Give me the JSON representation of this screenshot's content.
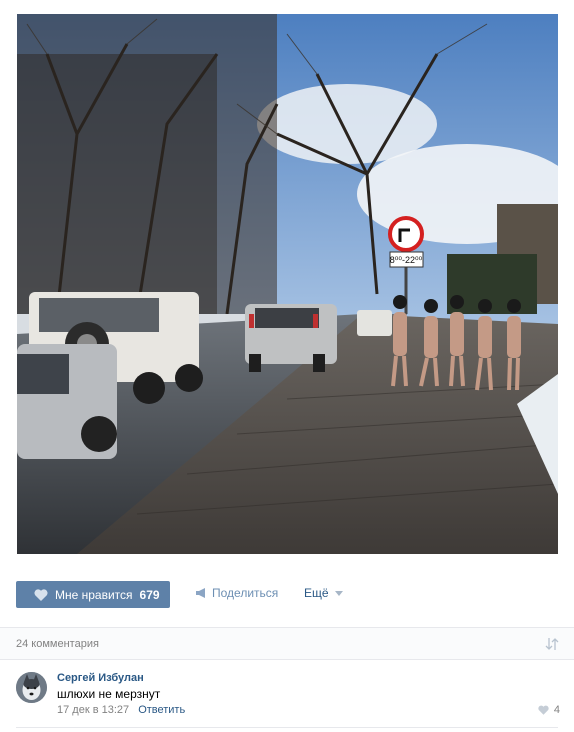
{
  "post": {
    "like_label": "Мне нравится",
    "like_count": "679",
    "share_label": "Поделиться",
    "more_label": "Ещё"
  },
  "comments": {
    "count_label": "24 комментария",
    "items": [
      {
        "author": "Сергей Избулан",
        "text": "шлюхи не мерзнут",
        "date": "17 дек в 13:27",
        "reply_label": "Ответить",
        "likes": "4"
      }
    ]
  },
  "photo_sign": {
    "plate_text": "8⁰⁰-22⁰⁰"
  },
  "colors": {
    "like_button": "#5e81a8",
    "link": "#2a5885",
    "muted": "#828282"
  }
}
